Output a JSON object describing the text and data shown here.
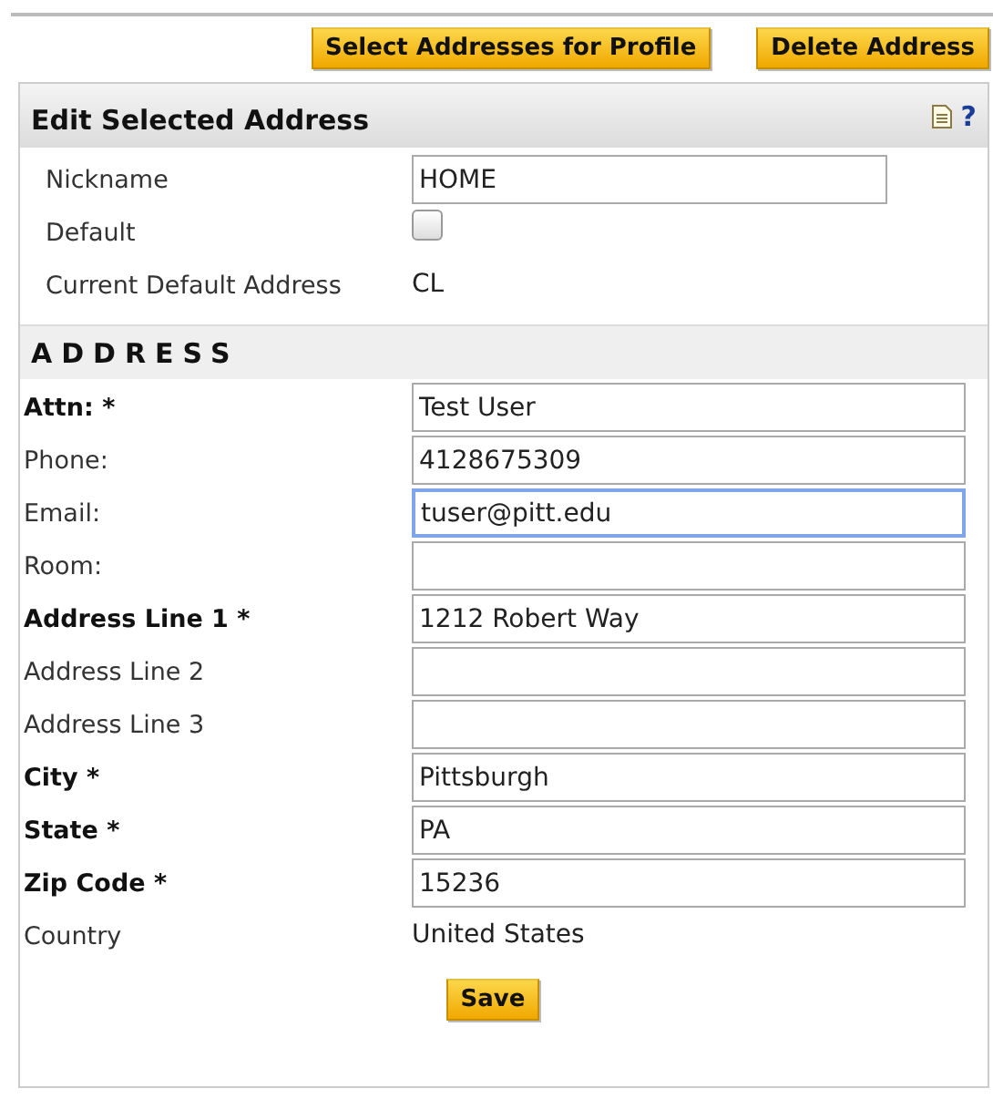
{
  "toolbar": {
    "buttons": [
      "Select Addresses for Profile",
      "Delete Address"
    ]
  },
  "panel": {
    "title": "Edit Selected Address",
    "help": "?",
    "general_rows": [
      {
        "label": "Nickname",
        "kind": "text",
        "value": "HOME"
      },
      {
        "label": "Default",
        "kind": "checkbox",
        "checked": false
      },
      {
        "label": "Current Default Address",
        "kind": "static",
        "value": "CL"
      }
    ],
    "section_title": "ADDRESS",
    "address_rows": [
      {
        "label": "Attn: *",
        "kind": "text",
        "required": true,
        "value": "Test User",
        "focused": false
      },
      {
        "label": "Phone:",
        "kind": "text",
        "required": false,
        "value": "4128675309",
        "focused": false
      },
      {
        "label": "Email:",
        "kind": "text",
        "required": false,
        "value": "tuser@pitt.edu",
        "focused": true
      },
      {
        "label": "Room:",
        "kind": "text",
        "required": false,
        "focused": false
      },
      {
        "label": "Address Line 1 *",
        "kind": "text",
        "required": true,
        "value": "1212 Robert Way",
        "focused": false
      },
      {
        "label": "Address Line 2",
        "kind": "text",
        "required": false,
        "focused": false
      },
      {
        "label": "Address Line 3",
        "kind": "text",
        "required": false,
        "focused": false
      },
      {
        "label": "City *",
        "kind": "text",
        "required": true,
        "value": "Pittsburgh",
        "focused": false
      },
      {
        "label": "State *",
        "kind": "text",
        "required": true,
        "value": "PA",
        "focused": false
      },
      {
        "label": "Zip Code *",
        "kind": "text",
        "required": true,
        "value": "15236",
        "focused": false
      },
      {
        "label": "Country",
        "kind": "static",
        "required": false,
        "value": "United States"
      }
    ],
    "save_button": "Save"
  }
}
